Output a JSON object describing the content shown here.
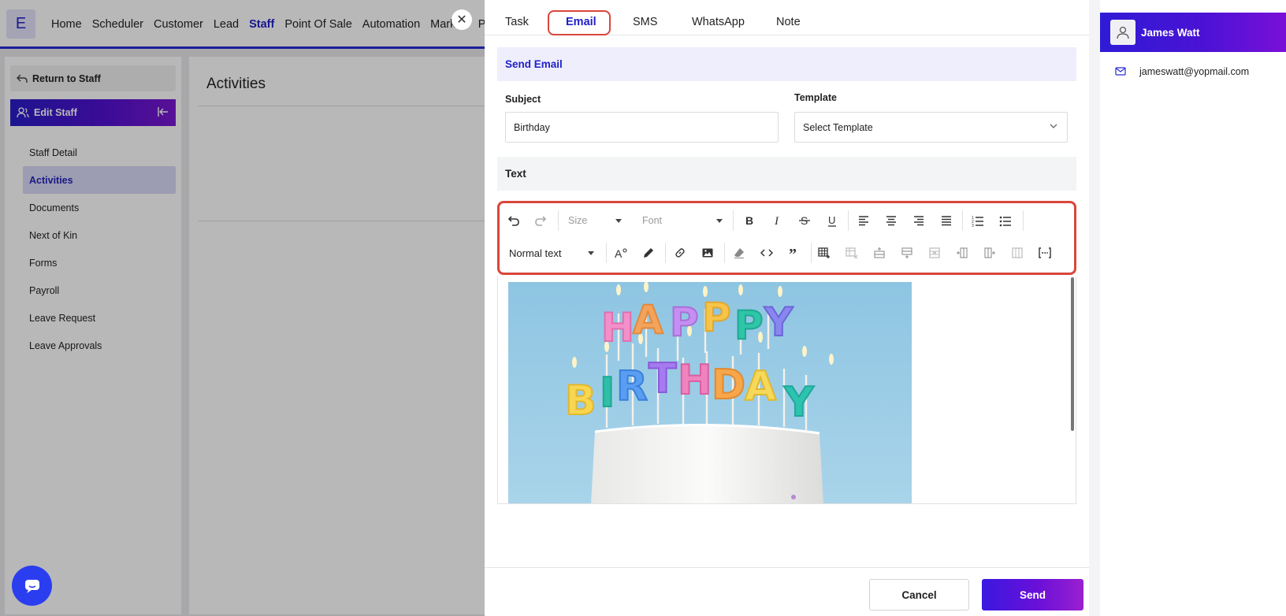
{
  "app": {
    "logo_letter": "E",
    "nav": [
      "Home",
      "Scheduler",
      "Customer",
      "Lead",
      "Staff",
      "Point Of Sale",
      "Automation",
      "Marketi",
      "Pro"
    ],
    "nav_active": "Staff"
  },
  "sidebar": {
    "return_label": "Return to Staff",
    "section_title": "Edit Staff",
    "items": [
      "Staff Detail",
      "Activities",
      "Documents",
      "Next of Kin",
      "Forms",
      "Payroll",
      "Leave Request",
      "Leave Approvals"
    ],
    "active_item": "Activities"
  },
  "main": {
    "title": "Activities"
  },
  "drawer": {
    "tabs": [
      "Task",
      "Email",
      "SMS",
      "WhatsApp",
      "Note"
    ],
    "active_tab": "Email",
    "send_email_header": "Send Email",
    "subject": {
      "label": "Subject",
      "value": "Birthday"
    },
    "template": {
      "label": "Template",
      "value": "Select Template"
    },
    "text_header": "Text",
    "toolbar": {
      "size_placeholder": "Size",
      "font_placeholder": "Font",
      "block_format": "Normal text"
    },
    "editor_image_text": "HAPPY BIRTHDAY",
    "cancel_label": "Cancel",
    "send_label": "Send"
  },
  "contact": {
    "name": "James Watt",
    "email": "jameswatt@yopmail.com"
  },
  "colors": {
    "brand": "#2020c8",
    "highlight_ring": "#d9463b",
    "gradient_start": "#3a18e0",
    "gradient_end": "#9a20d0"
  }
}
